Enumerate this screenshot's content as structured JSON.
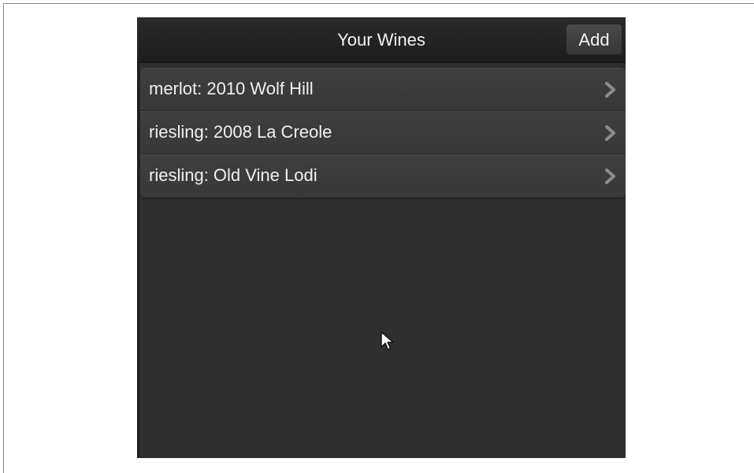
{
  "header": {
    "title": "Your Wines",
    "add_label": "Add"
  },
  "wines": [
    {
      "label": "merlot: 2010 Wolf Hill",
      "icon": "chevron-right-icon"
    },
    {
      "label": "riesling: 2008 La Creole",
      "icon": "chevron-right-icon"
    },
    {
      "label": "riesling: Old Vine Lodi",
      "icon": "chevron-right-icon"
    }
  ],
  "colors": {
    "background": "#2f2f2f",
    "header": "#1d1d1d",
    "row": "#3b3b3b",
    "text": "#f0f0f0",
    "chevron": "#8c8c8c"
  }
}
